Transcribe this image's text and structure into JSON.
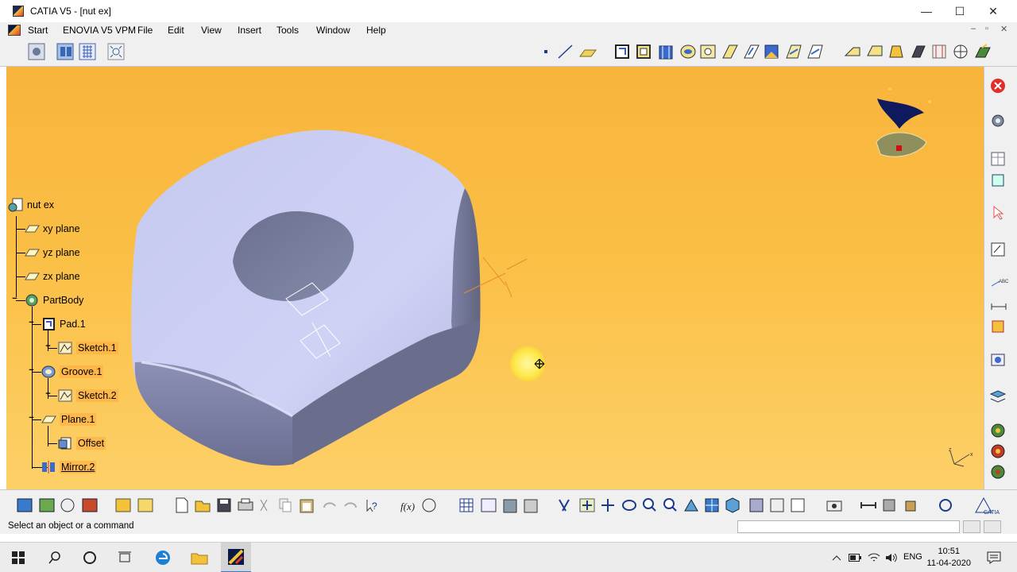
{
  "window": {
    "title": "CATIA V5 - [nut ex]",
    "controls": {
      "minimize": "—",
      "maximize": "☐",
      "close": "✕"
    }
  },
  "menu": {
    "items": [
      "Start",
      "ENOVIA V5 VPM",
      "File",
      "Edit",
      "View",
      "Insert",
      "Tools",
      "Window",
      "Help"
    ],
    "mdi_controls": [
      "–",
      "▫",
      "✕"
    ]
  },
  "tree": {
    "root": "nut ex",
    "items": [
      {
        "label": "xy plane",
        "icon": "plane-icon"
      },
      {
        "label": "yz plane",
        "icon": "plane-icon"
      },
      {
        "label": "zx plane",
        "icon": "plane-icon"
      },
      {
        "label": "PartBody",
        "icon": "partbody-gear-icon"
      },
      {
        "label": "Pad.1",
        "icon": "pad-icon"
      },
      {
        "label": "Sketch.1",
        "icon": "sketch-icon"
      },
      {
        "label": "Groove.1",
        "icon": "groove-icon"
      },
      {
        "label": "Sketch.2",
        "icon": "sketch-icon"
      },
      {
        "label": "Plane.1",
        "icon": "plane-icon"
      },
      {
        "label": "Offset",
        "icon": "offset-icon"
      },
      {
        "label": "Mirror.2",
        "icon": "mirror-icon"
      }
    ]
  },
  "status": {
    "message": "Select an object or a command"
  },
  "taskbar": {
    "language": "ENG",
    "time": "10:51",
    "date": "11-04-2020"
  },
  "colors": {
    "viewport_top": "#f8b43c",
    "viewport_bottom": "#fdd068",
    "nut_light": "#c9cbee",
    "nut_shadow": "#6f7391",
    "compass_blue": "#0f1a5e",
    "compass_plate": "#8e8f5c",
    "close_red": "#e0302a"
  }
}
